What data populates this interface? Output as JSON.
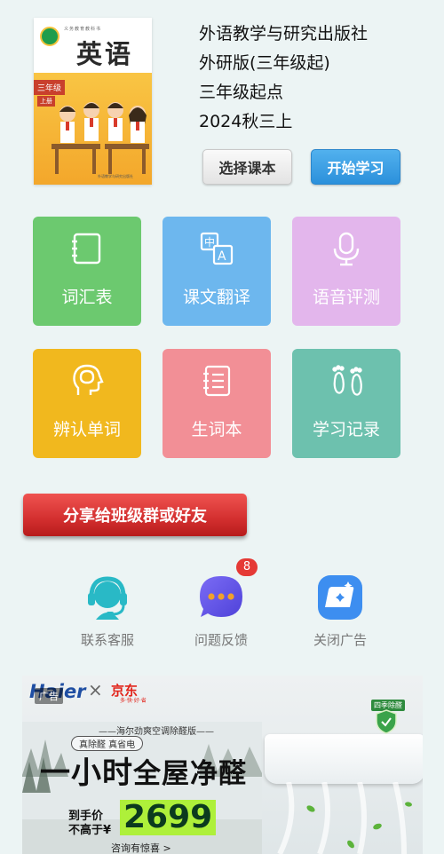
{
  "book": {
    "cover": {
      "series_text": "义务教育教科书",
      "title": "英语",
      "grade_label": "三年级",
      "volume_label": "上册",
      "publisher_text": "外语教学与研究出版社"
    },
    "publisher": "外语教学与研究出版社",
    "edition": "外研版(三年级起)",
    "level": "三年级起点",
    "term": "2024秋三上"
  },
  "actions": {
    "choose_label": "选择课本",
    "start_label": "开始学习"
  },
  "tiles": [
    {
      "label": "词汇表",
      "icon": "vocabulary-book-icon",
      "color": "#6cc96f"
    },
    {
      "label": "课文翻译",
      "icon": "translate-icon",
      "color": "#6db7ee"
    },
    {
      "label": "语音评测",
      "icon": "microphone-icon",
      "color": "#e3b6ec"
    },
    {
      "label": "辨认单词",
      "icon": "brain-head-icon",
      "color": "#f1b81e"
    },
    {
      "label": "生词本",
      "icon": "notebook-icon",
      "color": "#f28f96"
    },
    {
      "label": "学习记录",
      "icon": "footprints-icon",
      "color": "#6dc1ae"
    }
  ],
  "share_label": "分享给班级群或好友",
  "bottom_actions": [
    {
      "label": "联系客服",
      "icon": "headset-icon",
      "color": "#29b9c6"
    },
    {
      "label": "问题反馈",
      "icon": "chat-bubble-icon",
      "color": "#6b5cf0"
    },
    {
      "label": "关闭广告",
      "icon": "sparkle-card-icon",
      "color": "#3d8ef0"
    }
  ],
  "feedback_badge": "8",
  "ad": {
    "tag": "广告",
    "brand1": "Haier",
    "times": "×",
    "brand2": "京东",
    "brand2_slogan": "多·快·好·省",
    "season": "四季除醛",
    "subtitle": "——海尔劲爽空调除醛版——",
    "pill": "真除醛 真省电",
    "headline_part1": "一小时",
    "headline_part2": "全屋净醛",
    "price_line1": "到手价",
    "price_line2": "不高于¥",
    "price": "2699",
    "more": "咨询有惊喜 >"
  }
}
